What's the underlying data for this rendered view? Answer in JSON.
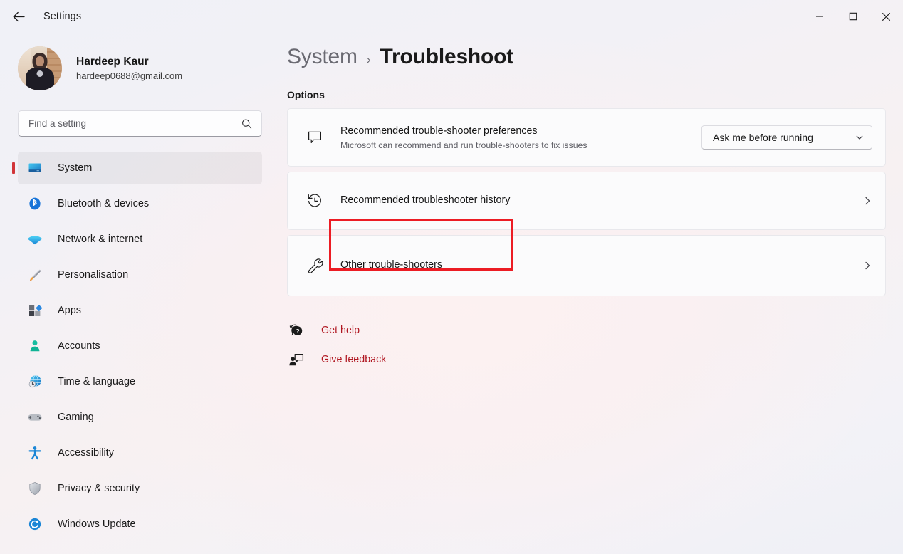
{
  "titlebar": {
    "back_label": "Back",
    "app_title": "Settings",
    "minimize_label": "Minimize",
    "maximize_label": "Maximize",
    "close_label": "Close"
  },
  "account": {
    "name": "Hardeep Kaur",
    "email": "hardeep0688@gmail.com"
  },
  "search": {
    "placeholder": "Find a setting",
    "value": "",
    "icon": "search-icon"
  },
  "sidebar": {
    "items": [
      {
        "label": "System",
        "icon": "monitor-icon",
        "selected": true
      },
      {
        "label": "Bluetooth & devices",
        "icon": "bluetooth-icon",
        "selected": false
      },
      {
        "label": "Network & internet",
        "icon": "wifi-icon",
        "selected": false
      },
      {
        "label": "Personalisation",
        "icon": "paintbrush-icon",
        "selected": false
      },
      {
        "label": "Apps",
        "icon": "apps-icon",
        "selected": false
      },
      {
        "label": "Accounts",
        "icon": "person-icon",
        "selected": false
      },
      {
        "label": "Time & language",
        "icon": "clock-globe-icon",
        "selected": false
      },
      {
        "label": "Gaming",
        "icon": "gamepad-icon",
        "selected": false
      },
      {
        "label": "Accessibility",
        "icon": "accessibility-icon",
        "selected": false
      },
      {
        "label": "Privacy & security",
        "icon": "shield-icon",
        "selected": false
      },
      {
        "label": "Windows Update",
        "icon": "update-icon",
        "selected": false
      }
    ]
  },
  "breadcrumb": {
    "parent": "System",
    "separator": "›",
    "current": "Troubleshoot"
  },
  "main": {
    "section_title": "Options",
    "cards": [
      {
        "title": "Recommended trouble-shooter preferences",
        "subtitle": "Microsoft can recommend and run trouble-shooters to fix issues",
        "icon": "speech-bubble-icon",
        "control": "dropdown",
        "dropdown_value": "Ask me before running"
      },
      {
        "title": "Recommended troubleshooter history",
        "subtitle": "",
        "icon": "history-clock-icon",
        "control": "chevron"
      },
      {
        "title": "Other trouble-shooters",
        "subtitle": "",
        "icon": "wrench-icon",
        "control": "chevron",
        "highlighted": true
      }
    ],
    "links": [
      {
        "label": "Get help",
        "icon": "help-question-icon"
      },
      {
        "label": "Give feedback",
        "icon": "feedback-person-icon"
      }
    ]
  },
  "colors": {
    "accent_selection": "#d13438",
    "link": "#b01721",
    "annotation": "#ec1c24",
    "card_bg": "#fbfbfc"
  }
}
